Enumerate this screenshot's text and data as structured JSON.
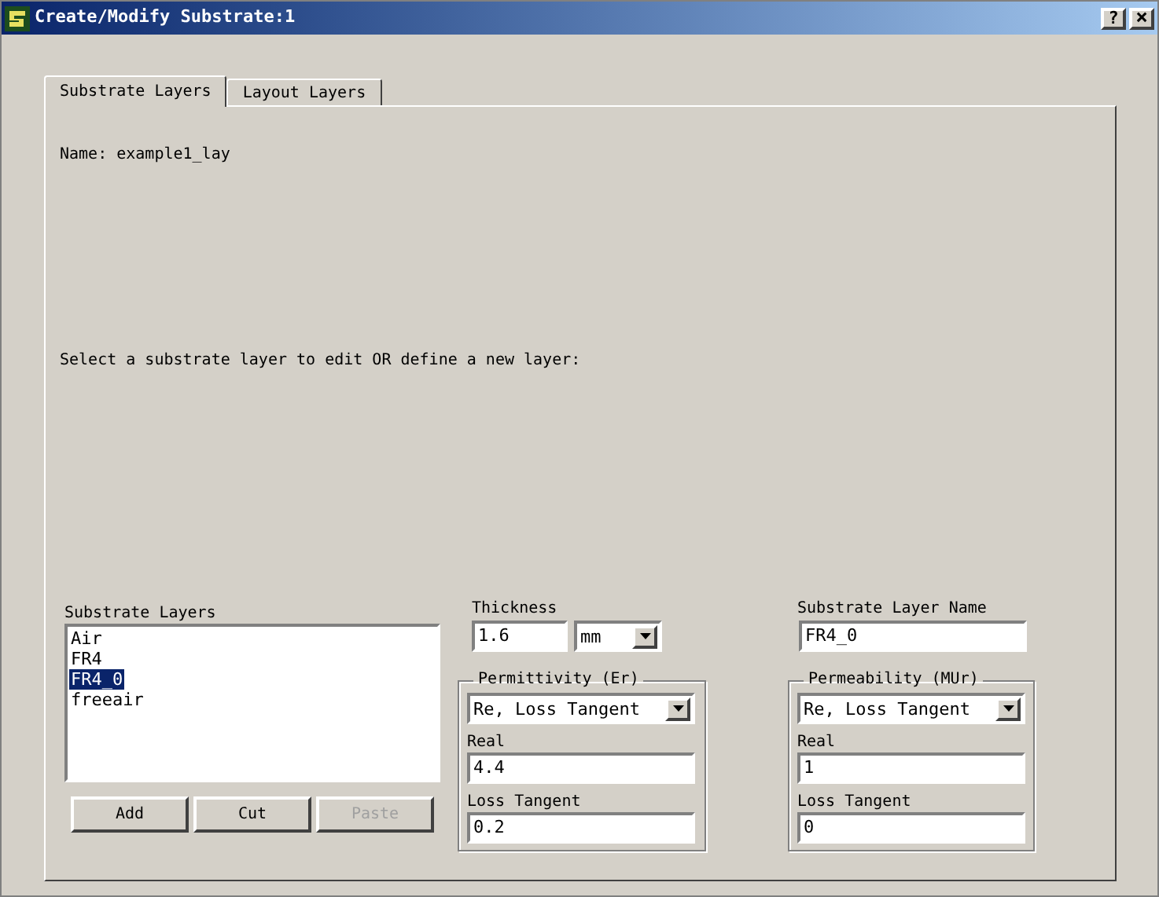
{
  "window": {
    "title": "Create/Modify Substrate:1",
    "help": "?",
    "close": "×"
  },
  "tabs": [
    {
      "label": "Substrate Layers",
      "selected": true
    },
    {
      "label": "Layout Layers",
      "selected": false
    }
  ],
  "name_line": "Name: example1_lay",
  "prompt": "Select a substrate layer to edit OR define a new layer:",
  "substrate_layers": {
    "label": "Substrate Layers",
    "items": [
      {
        "label": "Air",
        "selected": false
      },
      {
        "label": "FR4",
        "selected": false
      },
      {
        "label": "FR4_0",
        "selected": true
      },
      {
        "label": "freeair",
        "selected": false
      }
    ]
  },
  "layer_buttons": [
    {
      "label": "Add",
      "disabled": false
    },
    {
      "label": "Cut",
      "disabled": false
    },
    {
      "label": "Paste",
      "disabled": true
    }
  ],
  "thickness": {
    "label": "Thickness",
    "value": "1.6",
    "unit": "mm"
  },
  "permittivity": {
    "title": "Permittivity (Er)",
    "mode": "Re, Loss Tangent",
    "real_label": "Real",
    "real_value": "4.4",
    "loss_label": "Loss Tangent",
    "loss_value": "0.2"
  },
  "layer_name": {
    "label": "Substrate Layer Name",
    "value": "FR4_0"
  },
  "permeability": {
    "title": "Permeability (MUr)",
    "mode": "Re, Loss Tangent",
    "real_label": "Real",
    "real_value": "1",
    "loss_label": "Loss Tangent",
    "loss_value": "0"
  }
}
